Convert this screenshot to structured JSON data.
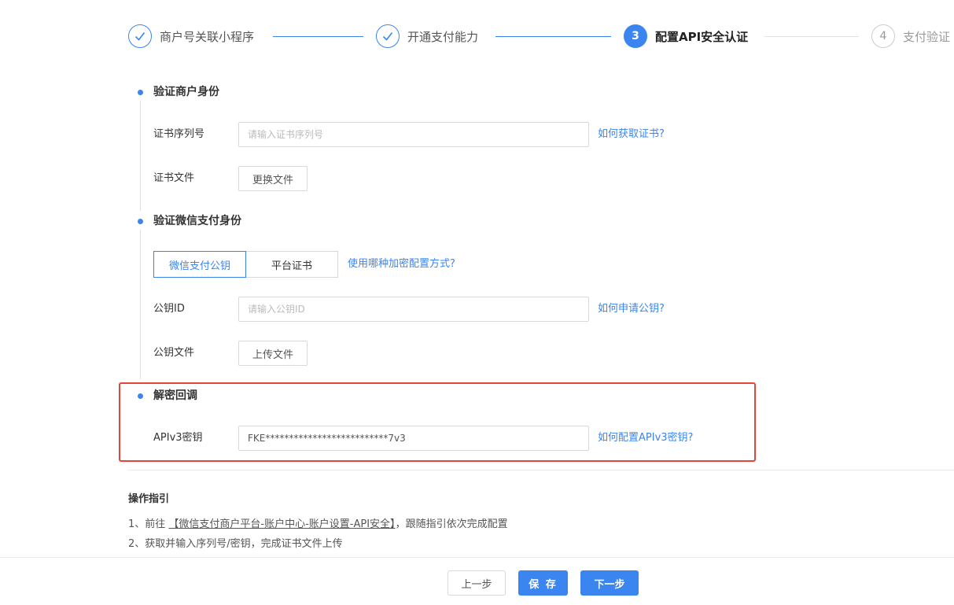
{
  "steps": [
    {
      "number": "1",
      "label": "商户号关联小程序",
      "state": "done"
    },
    {
      "number": "2",
      "label": "开通支付能力",
      "state": "done"
    },
    {
      "number": "3",
      "label": "配置API安全认证",
      "state": "active"
    },
    {
      "number": "4",
      "label": "支付验证",
      "state": "todo"
    }
  ],
  "merchant_section": {
    "title": "验证商户身份",
    "cert_serial_label": "证书序列号",
    "cert_serial_placeholder": "请输入证书序列号",
    "cert_serial_value": "",
    "cert_help_link": "如何获取证书?",
    "cert_file_label": "证书文件",
    "cert_file_button": "更换文件"
  },
  "wechat_section": {
    "title": "验证微信支付身份",
    "tabs": [
      {
        "label": "微信支付公钥",
        "selected": true
      },
      {
        "label": "平台证书",
        "selected": false
      }
    ],
    "encryption_help_link": "使用哪种加密配置方式?",
    "pubkey_id_label": "公钥ID",
    "pubkey_id_placeholder": "请输入公钥ID",
    "pubkey_id_value": "",
    "pubkey_help_link": "如何申请公钥?",
    "pubkey_file_label": "公钥文件",
    "pubkey_file_button": "上传文件"
  },
  "decrypt_section": {
    "title": "解密回调",
    "apiv3_label": "APIv3密钥",
    "apiv3_value": "FKE**************************7v3",
    "apiv3_help_link": "如何配置APIv3密钥?"
  },
  "guide": {
    "title": "操作指引",
    "line1_prefix": "1、前往",
    "line1_link": "【微信支付商户平台-账户中心-账户设置-API安全】",
    "line1_suffix": "，跟随指引依次完成配置",
    "line2": "2、获取并输入序列号/密钥，完成证书文件上传"
  },
  "footer": {
    "prev_label": "上一步",
    "save_label": "保 存",
    "next_label": "下一步"
  },
  "colors": {
    "primary": "#3a85f0",
    "highlight_border": "#e2453c",
    "divider": "#ebebeb",
    "muted": "#999999"
  },
  "icons": {
    "step_done": "check-icon",
    "timeline_dot": "dot-icon"
  }
}
